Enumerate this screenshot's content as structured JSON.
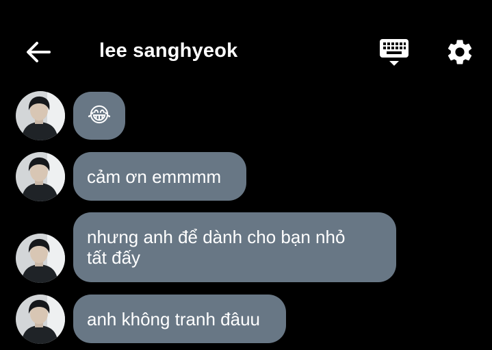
{
  "header": {
    "title": "lee sanghyeok"
  },
  "icons": {
    "back": "arrow-left-icon",
    "keyboard": "keyboard-icon",
    "settings": "gear-icon"
  },
  "colors": {
    "background": "#000000",
    "bubble": "#687785",
    "text": "#ffffff"
  },
  "messages": [
    {
      "text": "😂",
      "emoji": "face-with-tears-of-joy"
    },
    {
      "text": "cảm ơn emmmm"
    },
    {
      "text": "nhưng anh để dành cho bạn nhỏ tất đấy"
    },
    {
      "text": "anh không tranh đâuu"
    }
  ]
}
